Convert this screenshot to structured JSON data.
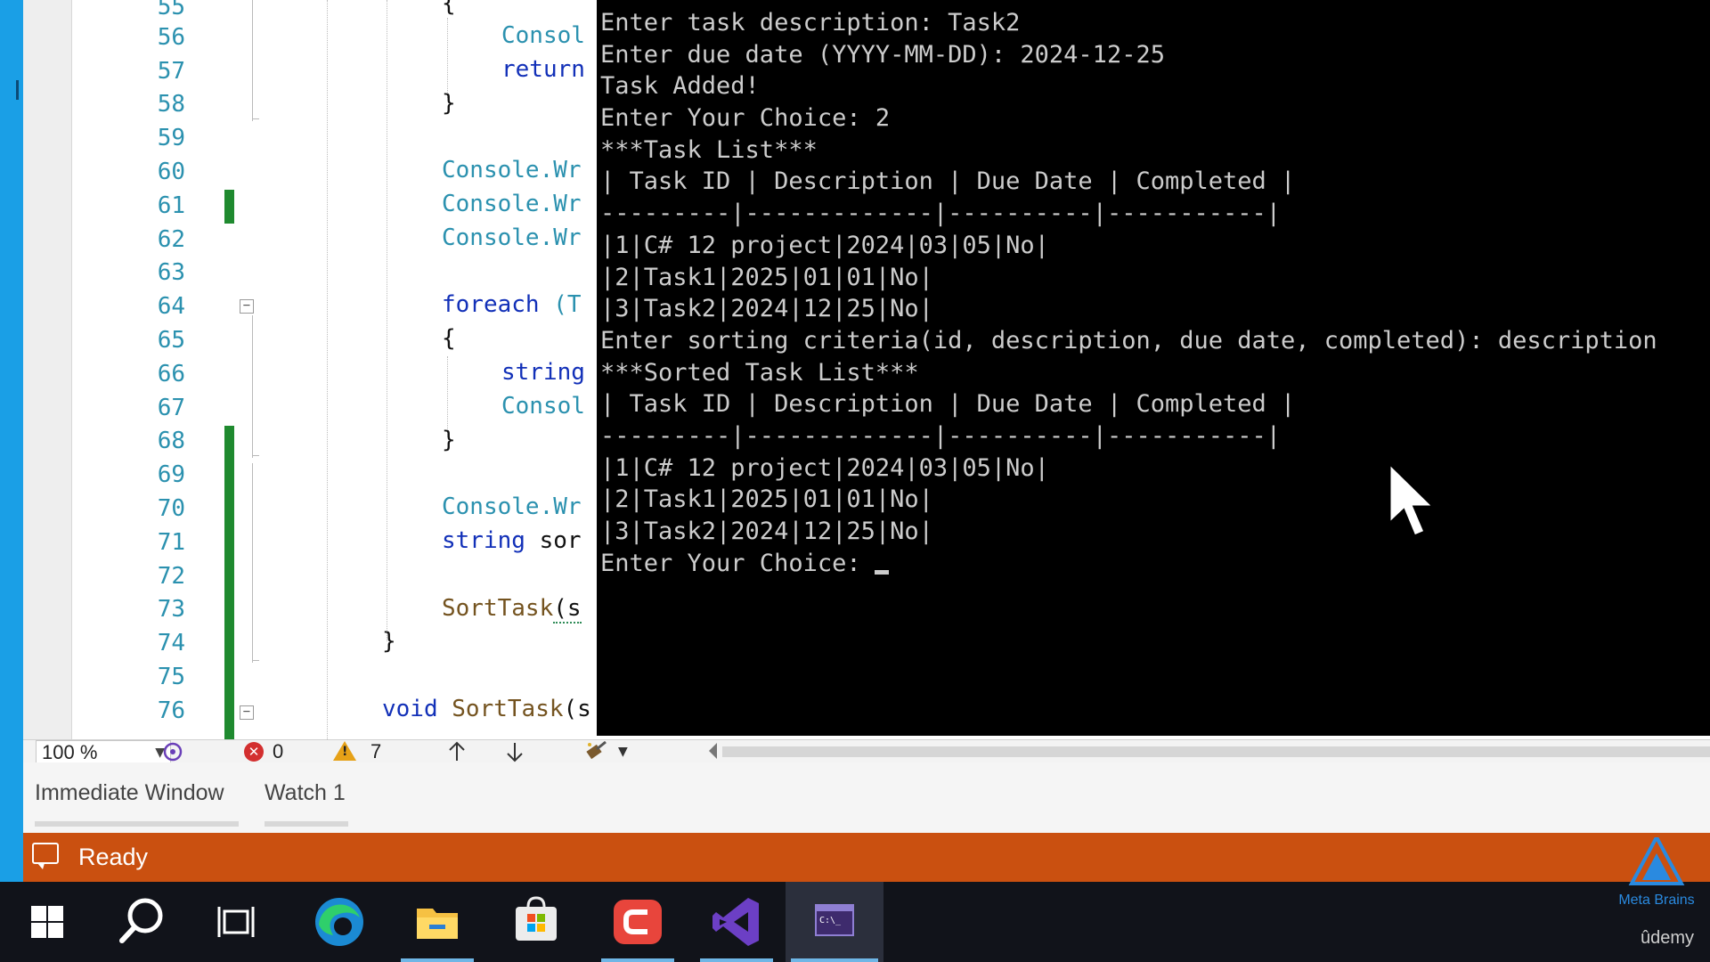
{
  "editor": {
    "line_numbers": [
      "55",
      "56",
      "57",
      "58",
      "59",
      "60",
      "61",
      "62",
      "63",
      "64",
      "65",
      "66",
      "67",
      "68",
      "69",
      "70",
      "71",
      "72",
      "73",
      "74",
      "75",
      "76"
    ],
    "code": {
      "l55": "{",
      "l56": "Consol",
      "l57": "return",
      "l58": "}",
      "l60": "Console.Wr",
      "l61": "Console.Wr",
      "l62": "Console.Wr",
      "l64_kw": "foreach",
      "l64_rest": " (T",
      "l65": "{",
      "l66": "string",
      "l67": "Consol",
      "l68": "}",
      "l70": "Console.Wr",
      "l71_kw": "string",
      "l71_rest": " sor",
      "l73_m": "SortTask",
      "l73_rest": "(s",
      "l74": "}",
      "l76_kw": "void",
      "l76_m": "SortTask",
      "l76_rest": "(s"
    }
  },
  "editor_status": {
    "zoom": "100 %",
    "errors": "0",
    "warnings": "7"
  },
  "tool_windows": {
    "tabs": [
      "Immediate Window",
      "Watch 1"
    ]
  },
  "status_bar": {
    "text": "Ready",
    "color": "#ca5010"
  },
  "console": {
    "lines": [
      "Enter task description: Task2",
      "Enter due date (YYYY-MM-DD): 2024-12-25",
      "Task Added!",
      "Enter Your Choice: 2",
      "***Task List***",
      "| Task ID | Description | Due Date | Completed |",
      "---------|-------------|----------|-----------|",
      "|1|C# 12 project|2024|03|05|No|",
      "|2|Task1|2025|01|01|No|",
      "|3|Task2|2024|12|25|No|",
      "Enter sorting criteria(id, description, due date, completed): description",
      "***Sorted Task List***",
      "| Task ID | Description | Due Date | Completed |",
      "---------|-------------|----------|-----------|",
      "|1|C# 12 project|2024|03|05|No|",
      "|2|Task1|2025|01|01|No|",
      "|3|Task2|2024|12|25|No|",
      "Enter Your Choice: "
    ]
  },
  "taskbar": {
    "icons": [
      "windows-start-icon",
      "search-icon",
      "task-view-icon",
      "edge-icon",
      "file-explorer-icon",
      "microsoft-store-icon",
      "app-icon",
      "visual-studio-icon",
      "command-prompt-icon"
    ]
  },
  "branding": {
    "name": "Meta Brains",
    "watermark": "ûdemy"
  }
}
